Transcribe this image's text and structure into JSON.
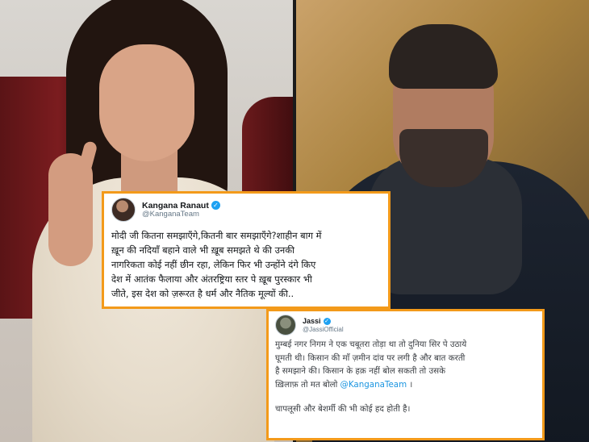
{
  "tweets": [
    {
      "display_name": "Kangana Ranaut",
      "handle": "@KanganaTeam",
      "verified": true,
      "lines": [
        "मोदी जी कितना समझाएँगे,कितनी बार समझाएँगे?शाहीन बाग में",
        "ख़ून की नदियाँ बहाने वाले भी ख़ूब समझते थे की उनकी",
        "नागरिकता कोई नहीं छीन रहा, लेकिन फिर भी उन्होंने दंगे किए",
        "देश में आतंक फैलाया और अंतरष्ट्रिया स्तर पे ख़ूब पुरस्कार भी",
        "जीते, इस देश को ज़रूरत है धर्म और नैतिक मूल्यों की.."
      ]
    },
    {
      "display_name": "Jassi",
      "handle": "@JassiOfficial",
      "verified": true,
      "lines": [
        "मुम्बई नगर निगम ने एक चबूतरा तोड़ा था तो दुनिया सिर पे उठाये",
        "घूमती थी। किसान की माँ ज़मीन दांव पर लगी है और बात करती",
        "है समझाने की। किसान के  हक़ नहीं बोल सकती तो उसके",
        "ख़िलाफ़ तो मत बोलो"
      ],
      "mention": "@KanganaTeam",
      "mention_suffix": " ।",
      "closing": "चापलूसी और बेशर्मी की भी कोई हद होती है।"
    }
  ],
  "colors": {
    "card_border": "#f39a1a",
    "verified_badge": "#1da1f2",
    "mention": "#1b95e0"
  },
  "icons": {
    "verified": "✓"
  }
}
